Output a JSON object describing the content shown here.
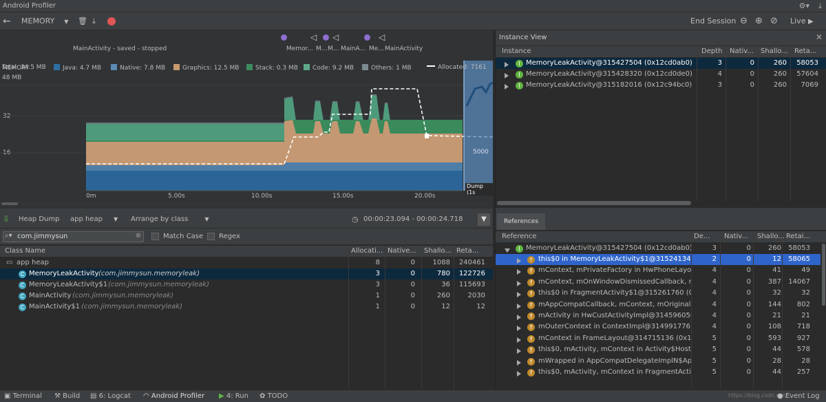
{
  "window": {
    "title": "Android Profiler"
  },
  "toolbar": {
    "profiler": "MEMORY",
    "end_session": "End Session",
    "live": "Live"
  },
  "timeline": {
    "events": [
      "MainActivity - saved - stopped",
      "Memor...",
      "M...",
      "M...",
      "MainA...",
      "Me...",
      "MainActivity"
    ],
    "chart_title": "MEMORY",
    "y_label_top": "48 MB",
    "y_ticks": [
      "32",
      "16"
    ],
    "x_ticks": [
      "0m",
      "5.00s",
      "10.00s",
      "15.00s",
      "20.00s"
    ],
    "right_tick": "5000",
    "dump_label": "Dump (1s"
  },
  "legend": {
    "total": "Total: 34.5 MB",
    "java": "Java: 4.7 MB",
    "native": "Native: 7.8 MB",
    "graphics": "Graphics: 12.5 MB",
    "stack": "Stack: 0.3 MB",
    "code": "Code: 9.2 MB",
    "others": "Others: 1 MB",
    "allocated": "Allocated: 7161"
  },
  "colors": {
    "java": "#2d6fa5",
    "native": "#5b8ab5",
    "graphics": "#c69a6e",
    "stack": "#3d8c5f",
    "code": "#5fa888",
    "others": "#7a8a90"
  },
  "heap": {
    "dump_label": "Heap Dump",
    "heap_select": "app heap",
    "arrange_select": "Arrange by class",
    "time_range": "00:00:23.094 - 00:00:24.718",
    "search_value": "com.jimmysun",
    "match_case": "Match Case",
    "regex": "Regex",
    "columns": [
      "Class Name",
      "Allocati...",
      "Native...",
      "Shallo...",
      "Reta..."
    ],
    "root": {
      "name": "app heap",
      "alloc": "8",
      "native": "0",
      "shallow": "1088",
      "retained": "240461"
    },
    "rows": [
      {
        "name": "MemoryLeakActivity",
        "pkg": "(com.jimmysun.memoryleak)",
        "alloc": "3",
        "native": "0",
        "shallow": "780",
        "retained": "122726"
      },
      {
        "name": "MemoryLeakActivity$1",
        "pkg": "(com.jimmysun.memoryleak)",
        "alloc": "3",
        "native": "0",
        "shallow": "36",
        "retained": "115693"
      },
      {
        "name": "MainActivity",
        "pkg": "(com.jimmysun.memoryleak)",
        "alloc": "1",
        "native": "0",
        "shallow": "260",
        "retained": "2030"
      },
      {
        "name": "MainActivity$1",
        "pkg": "(com.jimmysun.memoryleak)",
        "alloc": "1",
        "native": "0",
        "shallow": "12",
        "retained": "12"
      }
    ]
  },
  "instance_view": {
    "title": "Instance View",
    "columns": [
      "Instance",
      "Depth",
      "Nativ...",
      "Shallo...",
      "Reta..."
    ],
    "rows": [
      {
        "name": "MemoryLeakActivity@315427504 (0x12cd0ab0)",
        "depth": "3",
        "native": "0",
        "shallow": "260",
        "retained": "58053"
      },
      {
        "name": "MemoryLeakActivity@315428320 (0x12cd0de0)",
        "depth": "4",
        "native": "0",
        "shallow": "260",
        "retained": "57604"
      },
      {
        "name": "MemoryLeakActivity@315182016 (0x12c94bc0)",
        "depth": "3",
        "native": "0",
        "shallow": "260",
        "retained": "7069"
      }
    ]
  },
  "references": {
    "tab": "References",
    "columns": [
      "Reference",
      "De...",
      "Nativ...",
      "Shallo...",
      "Retai..."
    ],
    "root": {
      "name": "MemoryLeakActivity@315427504 (0x12cd0ab0)",
      "depth": "3",
      "native": "0",
      "shallow": "260",
      "retained": "58053"
    },
    "rows": [
      {
        "name": "this$0 in MemoryLeakActivity$1@31524134",
        "depth": "2",
        "native": "0",
        "shallow": "12",
        "retained": "58065"
      },
      {
        "name": "mContext, mPrivateFactory in HwPhoneLayout",
        "depth": "4",
        "native": "0",
        "shallow": "41",
        "retained": "49"
      },
      {
        "name": "mContext, mOnWindowDismissedCallback, m",
        "depth": "4",
        "native": "0",
        "shallow": "387",
        "retained": "14067"
      },
      {
        "name": "this$0 in FragmentActivity$1@315261760 (0",
        "depth": "4",
        "native": "0",
        "shallow": "32",
        "retained": "32"
      },
      {
        "name": "mAppCompatCallback, mContext, mOriginalW",
        "depth": "4",
        "native": "0",
        "shallow": "144",
        "retained": "802"
      },
      {
        "name": "mActivity in HwCustActivityImpl@314596056",
        "depth": "4",
        "native": "0",
        "shallow": "21",
        "retained": "21"
      },
      {
        "name": "mOuterContext in ContextImpl@314991776",
        "depth": "4",
        "native": "0",
        "shallow": "108",
        "retained": "718"
      },
      {
        "name": "mContext in FrameLayout@314715136 (0x1",
        "depth": "5",
        "native": "0",
        "shallow": "593",
        "retained": "927"
      },
      {
        "name": "this$0, mActivity, mContext in Activity$HostCa",
        "depth": "5",
        "native": "0",
        "shallow": "44",
        "retained": "578"
      },
      {
        "name": "mWrapped in AppCompatDelegateImplN$Ap",
        "depth": "5",
        "native": "0",
        "shallow": "28",
        "retained": "28"
      },
      {
        "name": "this$0, mActivity, mContext in FragmentActivi",
        "depth": "5",
        "native": "0",
        "shallow": "44",
        "retained": "257"
      }
    ]
  },
  "statusbar": {
    "terminal": "Terminal",
    "build": "Build",
    "logcat": "6: Logcat",
    "profiler": "Android Profiler",
    "run": "4: Run",
    "todo": "TODO",
    "event_log": "Event Log",
    "watermark": "https://blog.csdn.net/..."
  }
}
